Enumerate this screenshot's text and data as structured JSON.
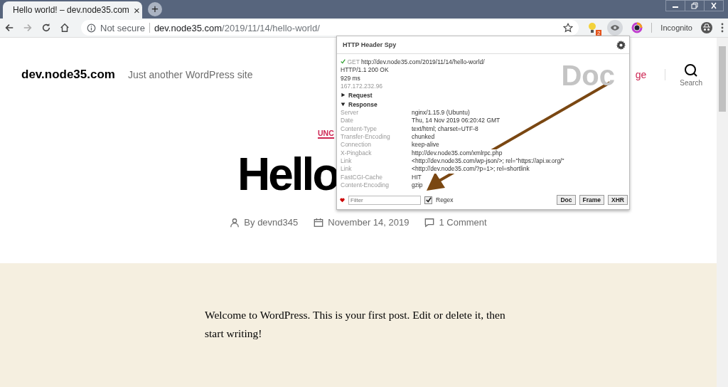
{
  "browser": {
    "tab": {
      "title": "Hello world! – dev.node35.com",
      "close": "×",
      "new_tab": "+"
    },
    "address_bar": {
      "security": "Not secure",
      "host": "dev.node35.com",
      "path": "/2019/11/14/hello-world/"
    },
    "extension_badge": "2",
    "profile": "Incognito"
  },
  "site": {
    "title": "dev.node35.com",
    "tagline": "Just another WordPress site",
    "nav_link": "ge",
    "search_label": "Search",
    "category": "UNC",
    "post_title": "Hello",
    "meta": [
      {
        "kind": "author",
        "text": "By devnd345"
      },
      {
        "kind": "date",
        "text": "November 14, 2019"
      },
      {
        "kind": "comments",
        "text": "1 Comment"
      }
    ],
    "content": "Welcome to WordPress. This is your first post. Edit or delete it, then start writing!"
  },
  "popup": {
    "title": "HTTP Header Spy",
    "method": "GET",
    "url": "http://dev.node35.com/2019/11/14/hello-world/",
    "status": "HTTP/1.1 200 OK",
    "time": "929 ms",
    "ip": "167.172.232.96",
    "type_label": "Doc",
    "sections": [
      {
        "label": "Request",
        "expanded": false
      },
      {
        "label": "Response",
        "expanded": true
      }
    ],
    "headers": [
      {
        "name": "Server",
        "value": "nginx/1.15.9 (Ubuntu)"
      },
      {
        "name": "Date",
        "value": "Thu, 14 Nov 2019 06:20:42 GMT"
      },
      {
        "name": "Content-Type",
        "value": "text/html; charset=UTF-8"
      },
      {
        "name": "Transfer-Encoding",
        "value": "chunked"
      },
      {
        "name": "Connection",
        "value": "keep-alive"
      },
      {
        "name": "X-Pingback",
        "value": "http://dev.node35.com/xmlrpc.php"
      },
      {
        "name": "Link",
        "value": "<http://dev.node35.com/wp-json/>; rel=\"https://api.w.org/\""
      },
      {
        "name": "Link",
        "value": "<http://dev.node35.com/?p=1>; rel=shortlink"
      },
      {
        "name": "FastCGI-Cache",
        "value": "HIT"
      },
      {
        "name": "Content-Encoding",
        "value": "gzip"
      }
    ],
    "filter": {
      "placeholder": "Filter"
    },
    "regex": {
      "label": "Regex",
      "checked": true
    },
    "buttons": [
      "Doc",
      "Frame",
      "XHR"
    ]
  }
}
